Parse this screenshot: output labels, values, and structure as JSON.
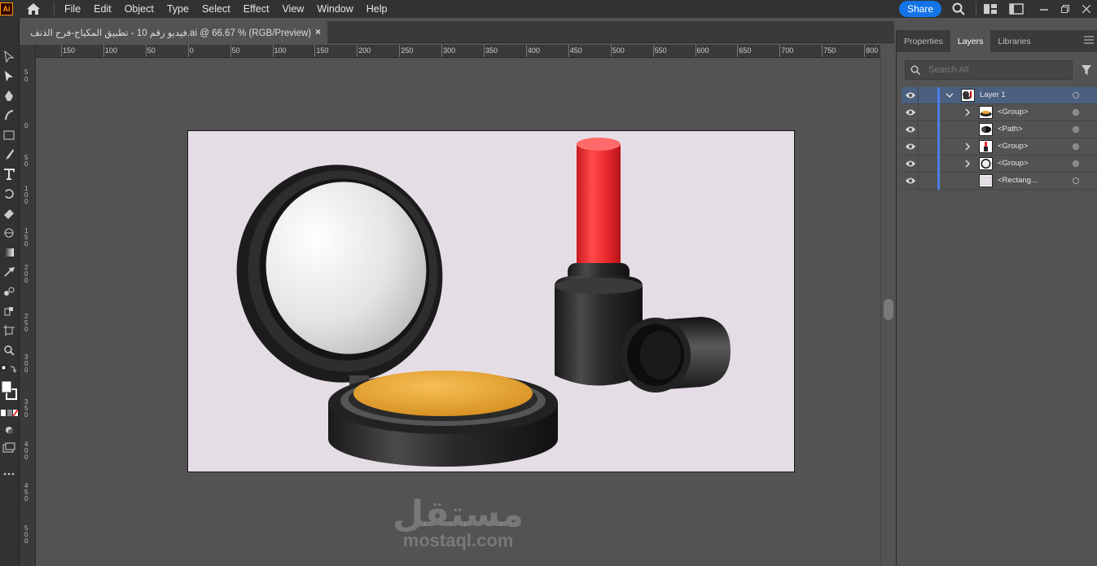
{
  "app": {
    "logo": "Ai"
  },
  "menu": [
    "File",
    "Edit",
    "Object",
    "Type",
    "Select",
    "Effect",
    "View",
    "Window",
    "Help"
  ],
  "topbar": {
    "share_label": "Share"
  },
  "document": {
    "tab_title": "فيديو رقم 10 - تطبيق المكياج-فرح الذنف.ai @ 66.67 % (RGB/Preview)",
    "close_glyph": "×"
  },
  "ruler": {
    "h_labels": [
      "150",
      "100",
      "50",
      "0",
      "50",
      "100",
      "150",
      "200",
      "250",
      "300",
      "350",
      "400",
      "450",
      "500",
      "550",
      "600",
      "650",
      "700",
      "750",
      "800"
    ],
    "v_labels": [
      "5",
      "0",
      "0",
      "5",
      "0",
      "1",
      "0",
      "0",
      "1",
      "5",
      "0",
      "2",
      "0",
      "0",
      "2",
      "5",
      "0",
      "3",
      "0",
      "0",
      "3",
      "5",
      "0",
      "4",
      "0",
      "0",
      "4",
      "5",
      "0",
      "5",
      "0",
      "0"
    ]
  },
  "panel": {
    "tabs": [
      "Properties",
      "Layers",
      "Libraries"
    ],
    "active_tab": "Layers",
    "search_placeholder": "Search All",
    "layers": [
      {
        "name": "Layer 1",
        "expanded": true,
        "selected": true,
        "level": 0,
        "has_children": true,
        "target_filled": false
      },
      {
        "name": "<Group>",
        "level": 1,
        "has_children": true,
        "target_filled": true
      },
      {
        "name": "<Path>",
        "level": 1,
        "has_children": false,
        "target_filled": true
      },
      {
        "name": "<Group>",
        "level": 1,
        "has_children": true,
        "target_filled": true
      },
      {
        "name": "<Group>",
        "level": 1,
        "has_children": true,
        "target_filled": true
      },
      {
        "name": "<Rectang...",
        "level": 1,
        "has_children": false,
        "target_filled": false
      }
    ]
  },
  "watermark": {
    "arabic": "مستقل",
    "latin": "mostaql.com"
  },
  "colors": {
    "accent": "#1473e6",
    "artboard": "#e5dde5",
    "lipstick": "#e8282d",
    "powder": "#e9a433",
    "layer_color": "#4d7ee8"
  }
}
